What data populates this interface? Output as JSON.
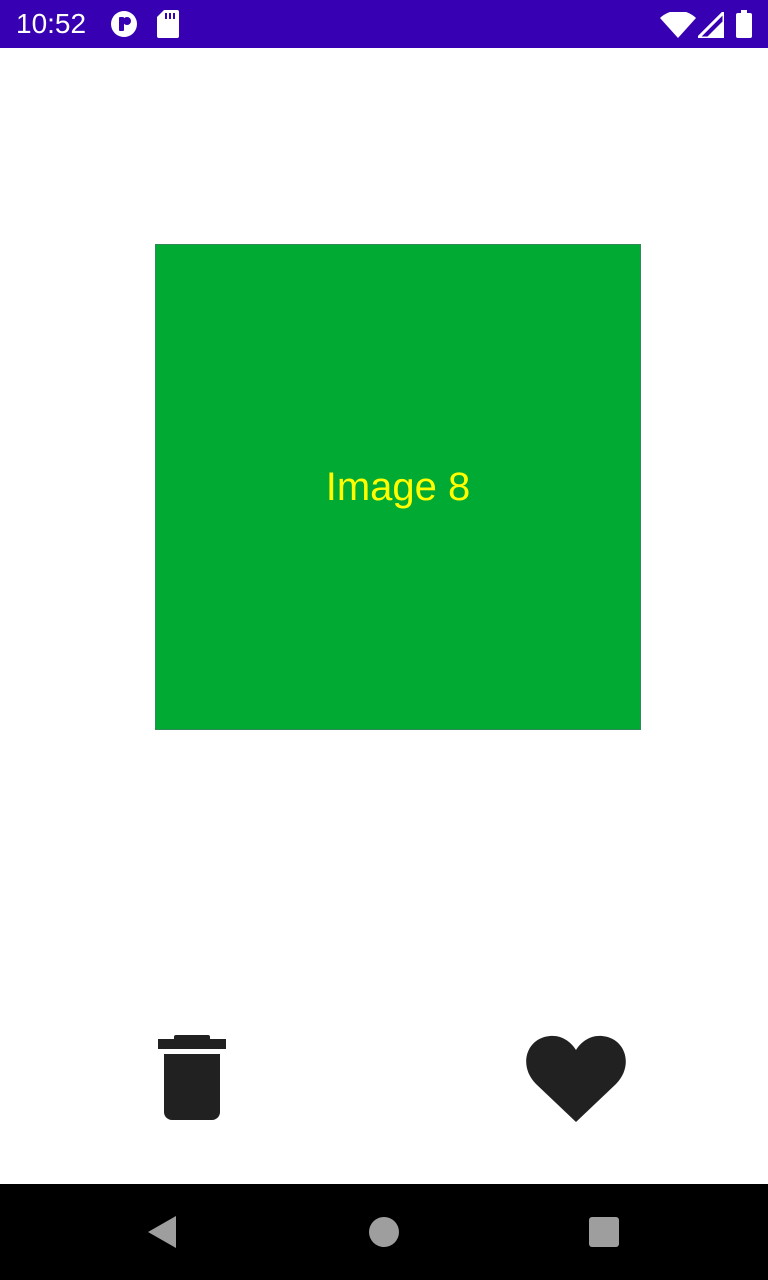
{
  "status_bar": {
    "time": "10:52",
    "icons": [
      "media-app-icon",
      "sd-card-icon",
      "wifi-icon",
      "cell-signal-icon",
      "battery-icon"
    ],
    "background_color": "#3700b3"
  },
  "main": {
    "image": {
      "label": "Image 8",
      "background_color": "#00aa33",
      "text_color": "#ffff00"
    },
    "actions": {
      "delete_icon": "trash-icon",
      "like_icon": "heart-icon",
      "icon_color": "#212121"
    }
  },
  "nav_bar": {
    "icons": [
      "back-icon",
      "home-icon",
      "recents-icon"
    ],
    "background_color": "#000000",
    "icon_color": "#9e9e9e"
  }
}
